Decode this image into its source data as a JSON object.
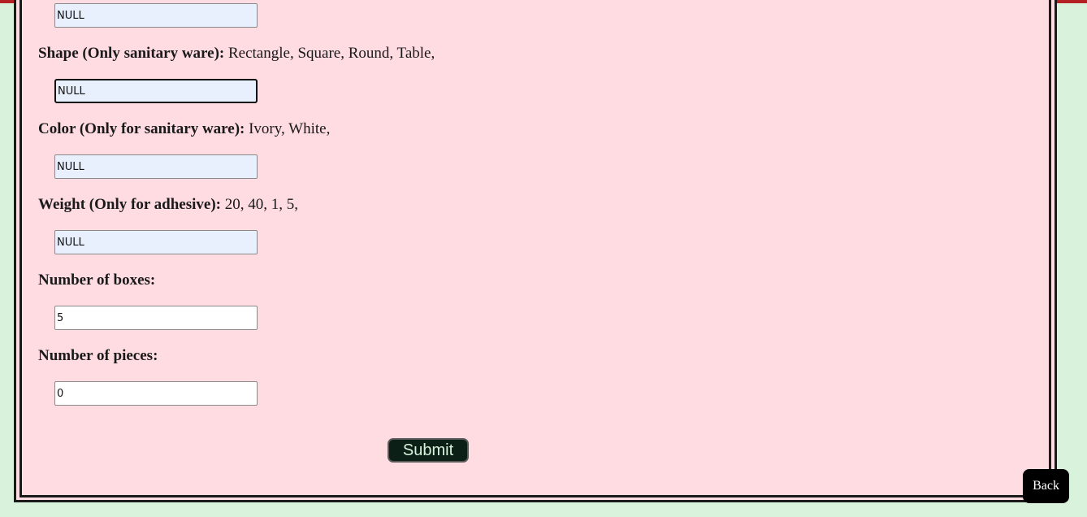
{
  "form": {
    "prev_field": {
      "value": "NULL"
    },
    "shape": {
      "label": "Shape (Only sanitary ware):",
      "options": "Rectangle, Square, Round, Table,",
      "value": "NULL"
    },
    "color": {
      "label": "Color (Only for sanitary ware):",
      "options": "Ivory, White,",
      "value": "NULL"
    },
    "weight": {
      "label": "Weight (Only for adhesive):",
      "options": "20, 40, 1, 5,",
      "value": "NULL"
    },
    "boxes": {
      "label": "Number of boxes:",
      "value": "5"
    },
    "pieces": {
      "label": "Number of pieces:",
      "value": "0"
    },
    "submit_label": "Submit"
  },
  "nav": {
    "back_label": "Back"
  },
  "colors": {
    "top_bar": "#b52025",
    "page_background": "#d9f2dc",
    "form_background": "#ffdbe2",
    "submit_background": "#0c1f17",
    "back_background": "#000000"
  }
}
